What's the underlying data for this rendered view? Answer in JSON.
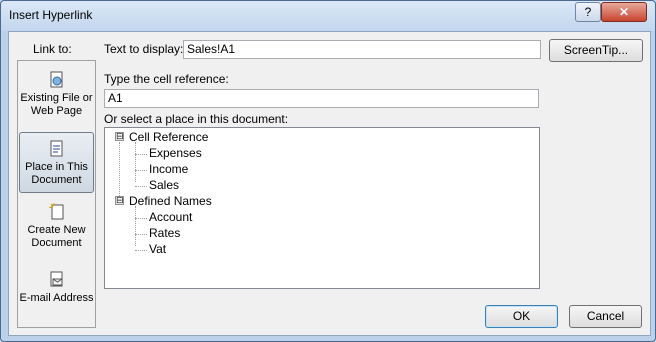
{
  "window": {
    "title": "Insert Hyperlink",
    "help_glyph": "?",
    "close_glyph": "✕"
  },
  "link_to": {
    "label": "Link to:",
    "items": [
      {
        "id": "existing",
        "icon": "globe-document-icon",
        "line1": "Existing File or",
        "line2": "Web Page",
        "selected": false
      },
      {
        "id": "place",
        "icon": "document-place-icon",
        "line1": "Place in This",
        "line2": "Document",
        "selected": true
      },
      {
        "id": "new",
        "icon": "new-document-icon",
        "line1": "Create New",
        "line2": "Document",
        "selected": false
      },
      {
        "id": "email",
        "icon": "email-icon",
        "line1": "E-mail Address",
        "line2": "",
        "selected": false
      }
    ]
  },
  "text_to_display": {
    "label": "Text to display:",
    "value": "Sales!A1"
  },
  "screentip_button": "ScreenTip...",
  "cell_reference": {
    "label": "Type the cell reference:",
    "value": "A1"
  },
  "place_select": {
    "label": "Or select a place in this document:"
  },
  "tree": [
    {
      "label": "Cell Reference",
      "expanded": true,
      "expander": "⊟",
      "children": [
        "Expenses",
        "Income",
        "Sales"
      ]
    },
    {
      "label": "Defined Names",
      "expanded": true,
      "expander": "⊟",
      "children": [
        "Account",
        "Rates",
        "Vat"
      ]
    }
  ],
  "buttons": {
    "ok": "OK",
    "cancel": "Cancel"
  }
}
